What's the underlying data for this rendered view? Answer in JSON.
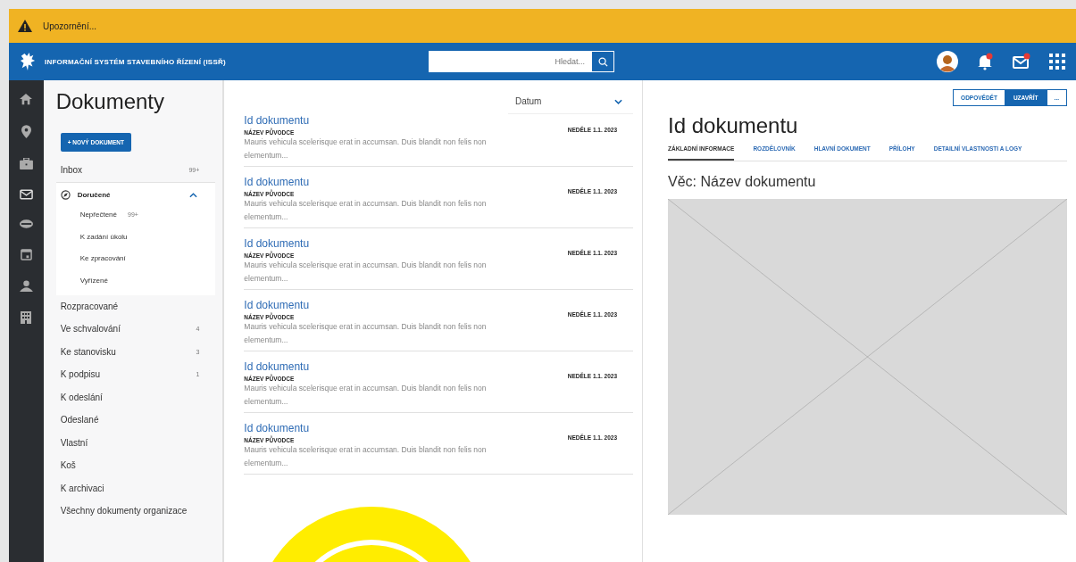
{
  "warning": {
    "text": "Upozornění..."
  },
  "header": {
    "title": "INFORMAČNÍ SYSTÉM STAVEBNÍHO ŘÍZENÍ (ISSŘ)",
    "search": {
      "placeholder": "Hledat..."
    }
  },
  "sidebar": {
    "title": "Dokumenty",
    "new_button": "+ NOVÝ DOKUMENT",
    "items": [
      {
        "label": "Inbox",
        "count": "99+"
      },
      {
        "label": "Doručené",
        "expanded": true,
        "children": [
          {
            "label": "Nepřečtené",
            "count": "99+"
          },
          {
            "label": "K zadání úkolu"
          },
          {
            "label": "Ke zpracování"
          },
          {
            "label": "Vyřízené"
          }
        ]
      },
      {
        "label": "Rozpracované"
      },
      {
        "label": "Ve schvalování",
        "count": "4"
      },
      {
        "label": "Ke stanovisku",
        "count": "3"
      },
      {
        "label": "K podpisu",
        "count": "1"
      },
      {
        "label": "K odeslání"
      },
      {
        "label": "Odeslané"
      },
      {
        "label": "Vlastní"
      },
      {
        "label": "Koš"
      },
      {
        "label": "K archivaci"
      },
      {
        "label": "Všechny dokumenty organizace"
      }
    ]
  },
  "list": {
    "sort": "Datum",
    "items": [
      {
        "title": "Id dokumentu",
        "originator": "NÁZEV PŮVODCE",
        "excerpt": "Mauris vehicula scelerisque erat in accumsan. Duis blandit non felis non elementum...",
        "date": "NEDĚLE 1.1. 2023"
      },
      {
        "title": "Id dokumentu",
        "originator": "NÁZEV PŮVODCE",
        "excerpt": "Mauris vehicula scelerisque erat in accumsan. Duis blandit non felis non elementum...",
        "date": "NEDĚLE 1.1. 2023"
      },
      {
        "title": "Id dokumentu",
        "originator": "NÁZEV PŮVODCE",
        "excerpt": "Mauris vehicula scelerisque erat in accumsan. Duis blandit non felis non elementum...",
        "date": "NEDĚLE 1.1. 2023"
      },
      {
        "title": "Id dokumentu",
        "originator": "NÁZEV PŮVODCE",
        "excerpt": "Mauris vehicula scelerisque erat in accumsan. Duis blandit non felis non elementum...",
        "date": "NEDĚLE 1.1. 2023"
      },
      {
        "title": "Id dokumentu",
        "originator": "NÁZEV PŮVODCE",
        "excerpt": "Mauris vehicula scelerisque erat in accumsan. Duis blandit non felis non elementum...",
        "date": "NEDĚLE 1.1. 2023"
      },
      {
        "title": "Id dokumentu",
        "originator": "NÁZEV PŮVODCE",
        "excerpt": "Mauris vehicula scelerisque erat in accumsan. Duis blandit non felis non elementum...",
        "date": "NEDĚLE 1.1. 2023"
      }
    ]
  },
  "detail": {
    "actions": [
      {
        "label": "ODPOVĚDĚT",
        "kind": "outline"
      },
      {
        "label": "UZAVŘÍT",
        "kind": "primary"
      },
      {
        "label": "...",
        "kind": "outline"
      }
    ],
    "title": "Id dokumentu",
    "tabs": [
      {
        "label": "ZÁKLADNÍ INFORMACE",
        "selected": true
      },
      {
        "label": "ROZDĚLOVNÍK",
        "selected": false
      },
      {
        "label": "HLAVNÍ DOKUMENT",
        "selected": false
      },
      {
        "label": "PŘÍLOHY",
        "selected": false
      },
      {
        "label": "DETAILNÍ VLASTNOSTI A LOGY",
        "selected": false
      }
    ],
    "subject": "Věc: Název dokumentu"
  }
}
